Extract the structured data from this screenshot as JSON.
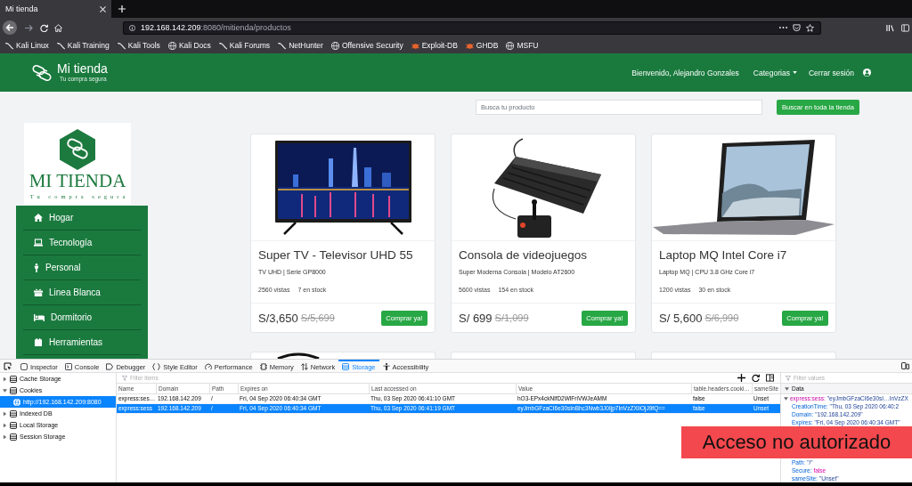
{
  "browser": {
    "tabs": [
      {
        "title": "Mi tienda",
        "selected": true
      }
    ],
    "url": {
      "host": "192.168.142.209",
      "rest": ":8080/mitienda/productos"
    },
    "bookmarks": [
      {
        "label": "Kali Linux",
        "kind": "kali"
      },
      {
        "label": "Kali Training",
        "kind": "kali"
      },
      {
        "label": "Kali Tools",
        "kind": "kali"
      },
      {
        "label": "Kali Docs",
        "kind": "site"
      },
      {
        "label": "Kali Forums",
        "kind": "kali"
      },
      {
        "label": "NetHunter",
        "kind": "kali"
      },
      {
        "label": "Offensive Security",
        "kind": "site"
      },
      {
        "label": "Exploit-DB",
        "kind": "exploit"
      },
      {
        "label": "GHDB",
        "kind": "exploit"
      },
      {
        "label": "MSFU",
        "kind": "site"
      }
    ]
  },
  "site": {
    "header": {
      "brand": "Mi tienda",
      "tagline": "Tu compra segura",
      "welcome": "Bienvenido, Alejandro Gonzales",
      "categories": "Categorias",
      "logout": "Cerrar sesión"
    },
    "search": {
      "placeholder": "Busca tu producto",
      "button": "Buscar en toda la tienda"
    },
    "logo": {
      "title": "MI TIENDA",
      "subtitle": "Tu compra segura"
    },
    "categories": [
      {
        "label": "Hogar",
        "kind": "home"
      },
      {
        "label": "Tecnología",
        "kind": "laptop"
      },
      {
        "label": "Personal",
        "kind": "person"
      },
      {
        "label": "Linea Blanca",
        "kind": "gift"
      },
      {
        "label": "Dormitorio",
        "kind": "bed"
      },
      {
        "label": "Herramientas",
        "kind": "calendar"
      }
    ],
    "products": [
      {
        "kind": "tv",
        "name": "Super TV - Televisor UHD 55",
        "subtitle": "TV UHD | Serie GP8000",
        "views": "2560 vistas",
        "stock": "7 en stock",
        "price": "S/3,650",
        "old_price": "S/5,699",
        "button": "Comprar ya!"
      },
      {
        "kind": "console",
        "name": "Consola de videojuegos",
        "subtitle": "Super Moderna Consola | Modelo AT2600",
        "views": "5600 vistas",
        "stock": "154 en stock",
        "price": "S/ 699",
        "old_price": "S/1,099",
        "button": "Comprar ya!"
      },
      {
        "kind": "laptop",
        "name": "Laptop MQ Intel Core i7",
        "subtitle": "Laptop MQ | CPU 3.8 GHz Core i7",
        "views": "1200 vistas",
        "stock": "30 en stock",
        "price": "S/ 5,600",
        "old_price": "S/6,990",
        "button": "Comprar ya!"
      }
    ],
    "more_products": [
      {
        "kind": "arc"
      },
      {
        "kind": "blank"
      },
      {
        "kind": "blank"
      }
    ]
  },
  "devtools": {
    "tools": [
      {
        "label": "Inspector",
        "kind": "inspector",
        "selected": false
      },
      {
        "label": "Console",
        "kind": "console",
        "selected": false
      },
      {
        "label": "Debugger",
        "kind": "debugger",
        "selected": false
      },
      {
        "label": "Style Editor",
        "kind": "style",
        "selected": false
      },
      {
        "label": "Performance",
        "kind": "performance",
        "selected": false
      },
      {
        "label": "Memory",
        "kind": "memory",
        "selected": false
      },
      {
        "label": "Network",
        "kind": "network",
        "selected": false
      },
      {
        "label": "Storage",
        "kind": "storage",
        "selected": true
      },
      {
        "label": "Accessibility",
        "kind": "accessibility",
        "selected": false
      }
    ],
    "tree": [
      {
        "label": "Cache Storage",
        "expanded": false,
        "selected": false
      },
      {
        "label": "Cookies",
        "expanded": true,
        "selected": false,
        "children": [
          {
            "label": "http://192.168.142.209:8080",
            "selected": true
          }
        ]
      },
      {
        "label": "Indexed DB",
        "expanded": false,
        "selected": false
      },
      {
        "label": "Local Storage",
        "expanded": false,
        "selected": false
      },
      {
        "label": "Session Storage",
        "expanded": false,
        "selected": false
      }
    ],
    "filter_placeholder": "Filter items",
    "table": {
      "columns": [
        "Name",
        "Domain",
        "Path",
        "Expires on",
        "Last accessed on",
        "Value",
        "table.headers.cooki…",
        "sameSite"
      ],
      "rows": [
        {
          "selected": false,
          "cells": [
            "express:ses…",
            "192.168.142.209",
            "/",
            "Fri, 04 Sep 2020 06:40:34 GMT",
            "Thu, 03 Sep 2020 06:41:10 GMT",
            "hO3-EPx4ckNlfD2WlFriVWJeAMM",
            "false",
            "Unset"
          ]
        },
        {
          "selected": true,
          "cells": [
            "express:sess",
            "192.168.142.209",
            "/",
            "Fri, 04 Sep 2020 06:40:34 GMT",
            "Thu, 03 Sep 2020 06:41:19 GMT",
            "eyJmbGFzaCI6e30sInBhc3Nwb3J0Ijp7InVzZXIiOjJ9fQ==",
            "false",
            "Unset"
          ]
        }
      ]
    },
    "sidebar": {
      "filter_placeholder": "Filter values",
      "section": "Data",
      "expanded": true,
      "entry": {
        "key": "express:sess:",
        "value": "\"eyJmbGFzaCI6e30sI…InVzZX",
        "expanded": true,
        "children": [
          {
            "key": "CreationTime:",
            "value": "\"Thu, 03 Sep 2020 06:40:2",
            "kind": "string"
          },
          {
            "key": "Domain:",
            "value": "\"192.168.142.209\"",
            "kind": "string"
          },
          {
            "key": "Expires:",
            "value": "\"Fri, 04 Sep 2020 06:40:34 GMT\"",
            "kind": "string"
          }
        ],
        "children_after_banner": [
          {
            "key": "Path:",
            "value": "\"/\"",
            "kind": "string"
          },
          {
            "key": "Secure:",
            "value": "false",
            "kind": "boolean"
          },
          {
            "key": "sameSite:",
            "value": "\"Unset\"",
            "kind": "string"
          }
        ]
      }
    }
  },
  "overlay": {
    "text": "Acceso no autorizado"
  }
}
